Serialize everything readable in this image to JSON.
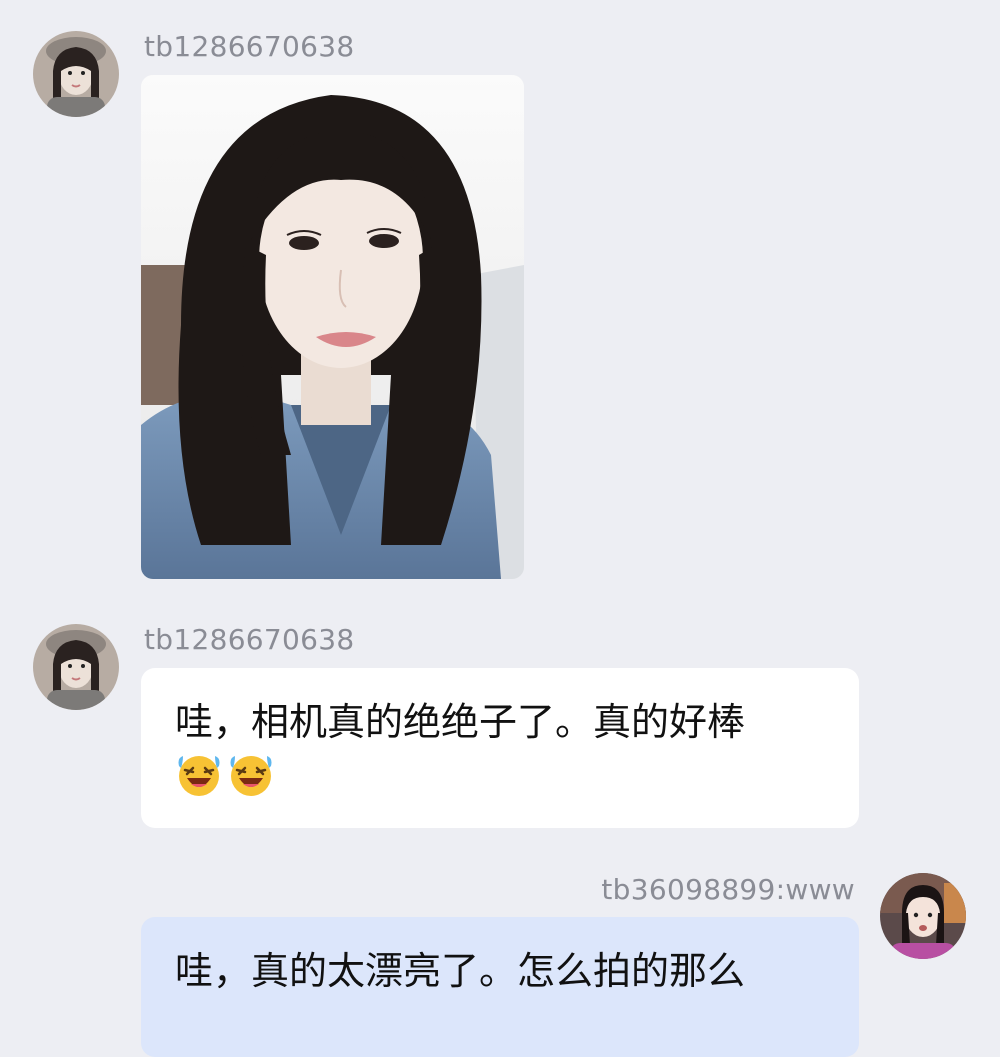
{
  "messages": [
    {
      "username": "tb1286670638",
      "type": "image",
      "image_description_icon": "selfie-photo"
    },
    {
      "username": "tb1286670638",
      "type": "text",
      "text": "哇，相机真的绝绝子了。真的好棒",
      "emojis": [
        "laughing-tears-emoji",
        "laughing-tears-emoji"
      ]
    },
    {
      "username": "tb36098899:www",
      "type": "text",
      "text": "哇，真的太漂亮了。怎么拍的那么"
    }
  ],
  "colors": {
    "background": "#edeef3",
    "incoming_bubble": "#ffffff",
    "outgoing_bubble": "#dce6fb",
    "username_text": "#8a8c95"
  }
}
